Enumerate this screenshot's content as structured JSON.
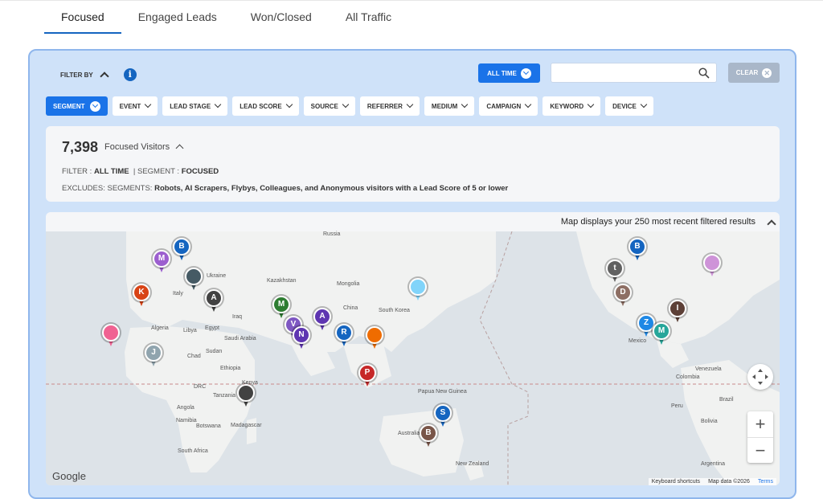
{
  "tabs": [
    {
      "label": "Focused",
      "active": true
    },
    {
      "label": "Engaged Leads",
      "active": false
    },
    {
      "label": "Won/Closed",
      "active": false
    },
    {
      "label": "All Traffic",
      "active": false
    }
  ],
  "filter_bar": {
    "filter_by_label": "FILTER BY",
    "info_icon": "i",
    "time_button": "ALL TIME",
    "search_value": "",
    "clear_label": "CLEAR"
  },
  "chips": [
    {
      "label": "SEGMENT",
      "active": true
    },
    {
      "label": "EVENT",
      "active": false
    },
    {
      "label": "LEAD STAGE",
      "active": false
    },
    {
      "label": "LEAD SCORE",
      "active": false
    },
    {
      "label": "SOURCE",
      "active": false
    },
    {
      "label": "REFERRER",
      "active": false
    },
    {
      "label": "MEDIUM",
      "active": false
    },
    {
      "label": "CAMPAIGN",
      "active": false
    },
    {
      "label": "KEYWORD",
      "active": false
    },
    {
      "label": "DEVICE",
      "active": false
    }
  ],
  "summary": {
    "count": "7,398",
    "count_label": "Focused Visitors",
    "filter_prefix": "FILTER : ",
    "filter_value": "ALL TIME",
    "segment_prefix": "|  SEGMENT : ",
    "segment_value": "FOCUSED",
    "excludes_prefix": "EXCLUDES: SEGMENTS: ",
    "excludes_value": "Robots, AI Scrapers, Flybys, Colleagues, and Anonymous visitors with a Lead Score of 5 or lower"
  },
  "map": {
    "header": "Map displays your 250 most recent filtered results",
    "google_logo": "Google",
    "keyboard_shortcuts": "Keyboard shortcuts",
    "map_data": "Map data ©2026",
    "terms": "Terms",
    "zoom_in": "+",
    "zoom_out": "−",
    "places": [
      "Russia",
      "Ukraine",
      "Italy",
      "Kazakhstan",
      "Mongolia",
      "China",
      "South Korea",
      "Iraq",
      "Saudi Arabia",
      "Egypt",
      "Libya",
      "Algeria",
      "Chad",
      "Sudan",
      "Ethiopia",
      "Kenya",
      "DRC",
      "Tanzania",
      "Angola",
      "Namibia",
      "Botswana",
      "Madagascar",
      "South Africa",
      "Papua New Guinea",
      "Australia",
      "New Zealand",
      "Mexico",
      "Venezuela",
      "Colombia",
      "Peru",
      "Brazil",
      "Bolivia",
      "Argentina"
    ],
    "pins": [
      {
        "letter": "M",
        "color": "#9c5fcf"
      },
      {
        "letter": "B",
        "color": "#1565c0"
      },
      {
        "letter": "K",
        "color": "#d84315"
      },
      {
        "letter": "",
        "color": "#f06292"
      },
      {
        "letter": "A",
        "color": "#424242"
      },
      {
        "letter": "",
        "color": "#455a64"
      },
      {
        "letter": "J",
        "color": "#90a4ae"
      },
      {
        "letter": "M",
        "color": "#2e7d32"
      },
      {
        "letter": "V",
        "color": "#7e57c2"
      },
      {
        "letter": "N",
        "color": "#5e35b1"
      },
      {
        "letter": "A",
        "color": "#5e35b1"
      },
      {
        "letter": "R",
        "color": "#1565c0"
      },
      {
        "letter": "",
        "color": "#ef6c00"
      },
      {
        "letter": "P",
        "color": "#c62828"
      },
      {
        "letter": "",
        "color": "#81d4fa"
      },
      {
        "letter": "",
        "color": "#424242"
      },
      {
        "letter": "S",
        "color": "#1565c0"
      },
      {
        "letter": "B",
        "color": "#795548"
      },
      {
        "letter": "B",
        "color": "#1565c0"
      },
      {
        "letter": "t",
        "color": "#616161"
      },
      {
        "letter": "D",
        "color": "#8d6e63"
      },
      {
        "letter": "Z",
        "color": "#1e88e5"
      },
      {
        "letter": "M",
        "color": "#26a69a"
      },
      {
        "letter": "I",
        "color": "#5d4037"
      },
      {
        "letter": "",
        "color": "#ce93d8"
      }
    ]
  }
}
